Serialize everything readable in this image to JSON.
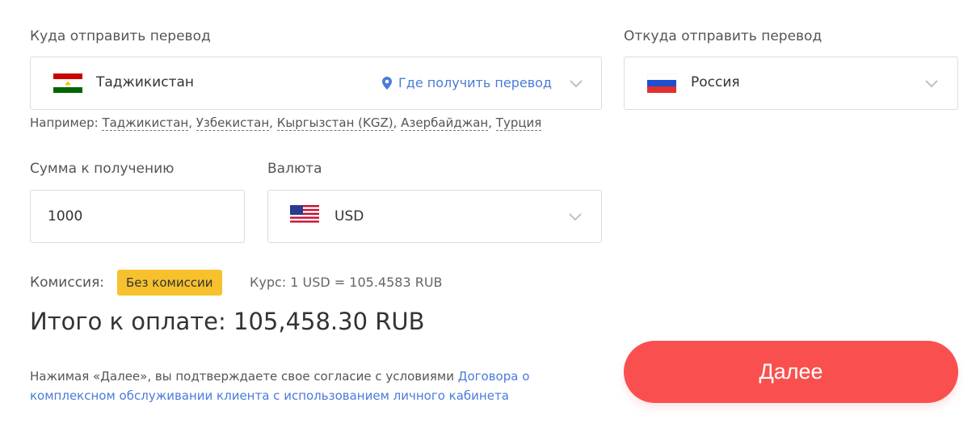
{
  "destination": {
    "label": "Куда отправить перевод",
    "country": "Таджикистан",
    "where_link": "Где получить перевод",
    "hint_prefix": "Например:",
    "examples": [
      "Таджикистан",
      "Узбекистан",
      "Кыргызстан (KGZ)",
      "Азербайджан",
      "Турция"
    ]
  },
  "origin": {
    "label": "Откуда отправить перевод",
    "country": "Россия"
  },
  "amount": {
    "label": "Сумма к получению",
    "value": "1000"
  },
  "currency": {
    "label": "Валюта",
    "value": "USD"
  },
  "fees": {
    "label": "Комиссия:",
    "badge": "Без комиссии",
    "rate": "Курс: 1 USD = 105.4583 RUB"
  },
  "total": "Итого к оплате: 105,458.30 RUB",
  "agreement": {
    "text": "Нажимая «Далее», вы подтверждаете свое согласие с условиями",
    "link": "Договора о комплексном обслуживании клиента с использованием личного кабинета"
  },
  "next_button": "Далее",
  "colors": {
    "accent_button": "#f9504f",
    "link": "#4a7bd9",
    "badge": "#f6c12c"
  },
  "icons": [
    "flag-tajikistan-icon",
    "location-pin-icon",
    "chevron-down-icon",
    "flag-russia-icon",
    "flag-usa-icon"
  ]
}
